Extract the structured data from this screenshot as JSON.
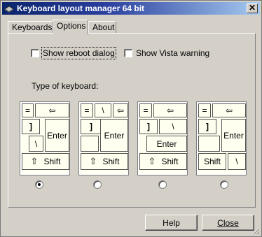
{
  "window": {
    "title": "Keyboard layout manager 64 bit",
    "close_glyph": "✕"
  },
  "tabs": [
    {
      "label": "Keyboards",
      "active": false
    },
    {
      "label": "Options",
      "active": true
    },
    {
      "label": "About",
      "active": false
    }
  ],
  "options": {
    "reboot_label": "Show reboot dialog",
    "reboot_checked": false,
    "vista_label": "Show Vista warning",
    "vista_checked": false,
    "type_label": "Type of keyboard:"
  },
  "keys": {
    "equals": "=",
    "backspace": "⇦",
    "backslash": "\\",
    "bracket": "]",
    "enter": "Enter",
    "shift_arrow": "⇧",
    "shift": "Shift"
  },
  "keyboard_selected_index": 0,
  "buttons": {
    "help": "Help",
    "close": "Close"
  }
}
